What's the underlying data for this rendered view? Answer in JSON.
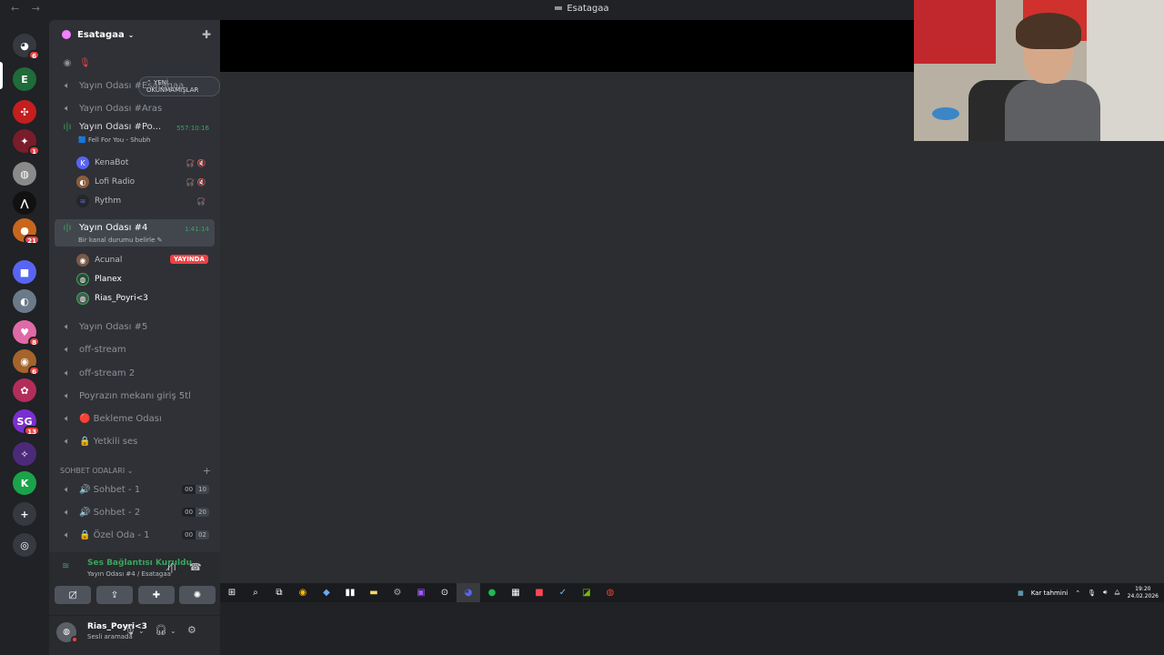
{
  "window": {
    "title": "Esatagaa",
    "back": "←",
    "forward": "→"
  },
  "guilds": [
    {
      "name": "discord-home",
      "glyph": "◕",
      "badge": "6",
      "color": "#36393f"
    },
    {
      "name": "esatagaa",
      "glyph": "E",
      "badge": "",
      "color": "#1f6b3a"
    },
    {
      "name": "server-2",
      "glyph": "✣",
      "badge": "",
      "color": "#c41e1e"
    },
    {
      "name": "server-3",
      "glyph": "✦",
      "badge": "1",
      "color": "#7a1c2a"
    },
    {
      "name": "server-4",
      "glyph": "◍",
      "badge": "",
      "color": "#8a8a8a"
    },
    {
      "name": "server-5",
      "glyph": "⋀",
      "badge": "",
      "color": "#111111"
    },
    {
      "name": "server-6",
      "glyph": "●",
      "badge": "21",
      "color": "#c8661e"
    },
    {
      "name": "server-7",
      "glyph": "■",
      "badge": "",
      "color": "#5865f2"
    },
    {
      "name": "server-8",
      "glyph": "◐",
      "badge": "",
      "color": "#6b7a88"
    },
    {
      "name": "server-9",
      "glyph": "♥",
      "badge": "8",
      "color": "#e06aa8"
    },
    {
      "name": "server-10",
      "glyph": "◉",
      "badge": "6",
      "color": "#a5642b"
    },
    {
      "name": "server-11",
      "glyph": "✿",
      "badge": "",
      "color": "#b32d5a"
    },
    {
      "name": "server-12",
      "glyph": "SG",
      "badge": "13",
      "color": "#7b2fd0"
    },
    {
      "name": "server-13",
      "glyph": "✧",
      "badge": "",
      "color": "#4c2a7a"
    },
    {
      "name": "server-14",
      "glyph": "K",
      "badge": "",
      "color": "#1aa34a"
    },
    {
      "name": "add-server",
      "glyph": "+",
      "badge": "",
      "color": "#36393f"
    },
    {
      "name": "explore",
      "glyph": "◎",
      "badge": "",
      "color": "#36393f"
    }
  ],
  "server": {
    "name": "Esatagaa",
    "chevron": "⌄",
    "invite_icon": "👤+",
    "unread_pill": "⌃ YENİ OKUNMAMIŞLAR"
  },
  "channels": [
    {
      "label": "Yayın Odası #Esatagaa"
    },
    {
      "label": "Yayın Odası #Aras"
    },
    {
      "label": "Yayın Odası #Po...",
      "timer": "557:10:16",
      "activity": "🟦 Fell For You - Shubh"
    },
    {
      "label": "Yayın Odası #4",
      "timer": "1:41:14",
      "activity": "Bir kanal durumu belirle ✎"
    },
    {
      "label": "Yayın Odası #5"
    },
    {
      "label": "off-stream"
    },
    {
      "label": "off-stream 2"
    },
    {
      "label": "Poyrazın mekanı giriş 5tl"
    },
    {
      "label": "🔴 Bekleme Odası"
    },
    {
      "label": "🔒 Yetkili ses"
    }
  ],
  "members_po": [
    {
      "name": "KenaBot",
      "icons": "🎧̸ 🔇"
    },
    {
      "name": "Lofi Radio",
      "icons": "🎧̸ 🔇"
    },
    {
      "name": "Rythm",
      "icons": "🎧̸"
    }
  ],
  "members_4": [
    {
      "name": "Acunal",
      "live": "YAYINDA"
    },
    {
      "name": "Planex"
    },
    {
      "name": "Rias_Poyri<3"
    }
  ],
  "category": {
    "label": "SOHBET ODALARI ⌄",
    "plus": "+"
  },
  "chat_channels": [
    {
      "label": "🔊 Sohbet - 1",
      "left": "00",
      "right": "10"
    },
    {
      "label": "🔊 Sohbet - 2",
      "left": "00",
      "right": "20"
    },
    {
      "label": "🔒 Özel Oda - 1",
      "left": "00",
      "right": "02"
    }
  ],
  "voice": {
    "status": "Ses Bağlantısı Kuruldu",
    "location": "Yayın Odası #4 / Esatagaa"
  },
  "user": {
    "name": "Rias_Poyri<3",
    "status": "Sesli aramada"
  },
  "taskbar": {
    "weather": "Kar tahmini",
    "time": "19:20",
    "date": "24.02.2026"
  }
}
